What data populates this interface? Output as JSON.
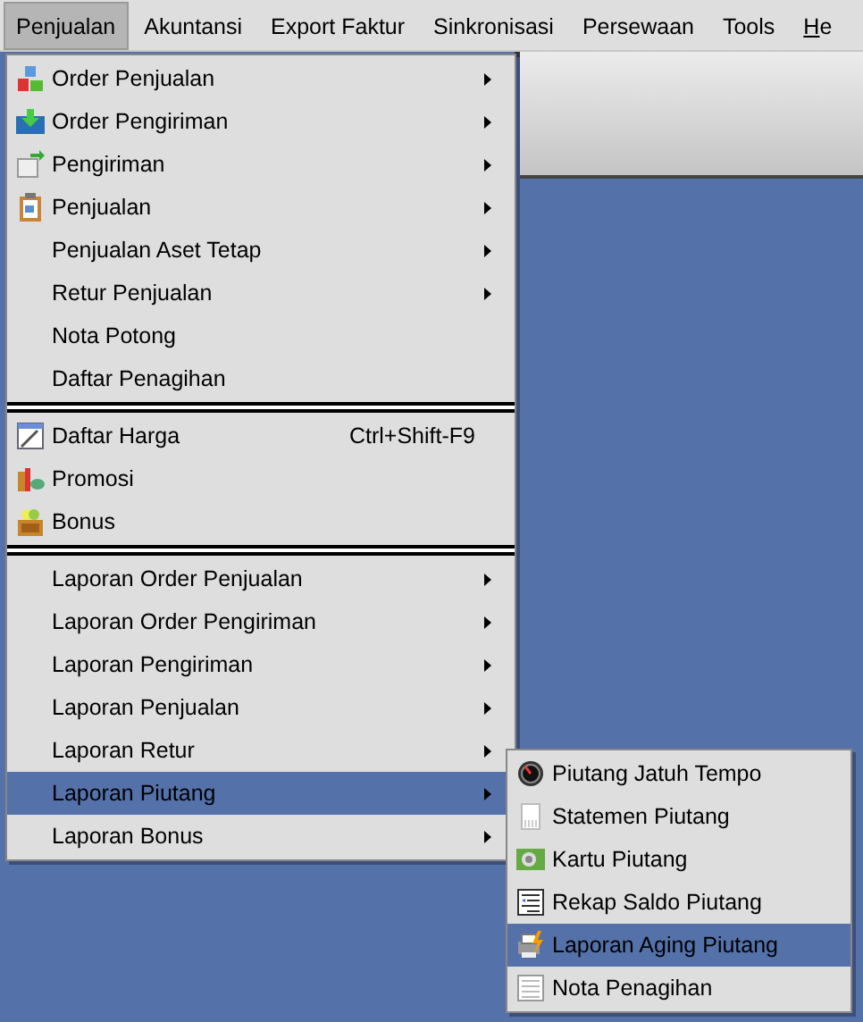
{
  "menubar": [
    {
      "label": "Penjualan",
      "selected": true
    },
    {
      "label": "Akuntansi",
      "selected": false
    },
    {
      "label": "Export Faktur",
      "selected": false
    },
    {
      "label": "Sinkronisasi",
      "selected": false
    },
    {
      "label": "Persewaan",
      "selected": false
    },
    {
      "label": "Tools",
      "selected": false
    },
    {
      "label": "He",
      "selected": false
    }
  ],
  "menu": [
    {
      "kind": "item",
      "label": "Order Penjualan",
      "has_icon": true,
      "submenu": true,
      "selected": false
    },
    {
      "kind": "item",
      "label": "Order Pengiriman",
      "has_icon": true,
      "submenu": true,
      "selected": false
    },
    {
      "kind": "item",
      "label": "Pengiriman",
      "has_icon": true,
      "submenu": true,
      "selected": false
    },
    {
      "kind": "item",
      "label": "Penjualan",
      "has_icon": true,
      "submenu": true,
      "selected": false
    },
    {
      "kind": "item",
      "label": "Penjualan Aset Tetap",
      "has_icon": false,
      "submenu": true,
      "selected": false
    },
    {
      "kind": "item",
      "label": "Retur Penjualan",
      "has_icon": false,
      "submenu": true,
      "selected": false
    },
    {
      "kind": "item",
      "label": "Nota Potong",
      "has_icon": false,
      "submenu": false,
      "selected": false
    },
    {
      "kind": "item",
      "label": "Daftar Penagihan",
      "has_icon": false,
      "submenu": false,
      "selected": false
    },
    {
      "kind": "separator"
    },
    {
      "kind": "item",
      "label": "Daftar Harga",
      "shortcut": "Ctrl+Shift-F9",
      "has_icon": true,
      "submenu": false,
      "selected": false
    },
    {
      "kind": "item",
      "label": "Promosi",
      "has_icon": true,
      "submenu": false,
      "selected": false
    },
    {
      "kind": "item",
      "label": "Bonus",
      "has_icon": true,
      "submenu": false,
      "selected": false
    },
    {
      "kind": "separator"
    },
    {
      "kind": "item",
      "label": "Laporan Order Penjualan",
      "has_icon": false,
      "submenu": true,
      "selected": false
    },
    {
      "kind": "item",
      "label": "Laporan Order Pengiriman",
      "has_icon": false,
      "submenu": true,
      "selected": false
    },
    {
      "kind": "item",
      "label": "Laporan Pengiriman",
      "has_icon": false,
      "submenu": true,
      "selected": false
    },
    {
      "kind": "item",
      "label": "Laporan Penjualan",
      "has_icon": false,
      "submenu": true,
      "selected": false
    },
    {
      "kind": "item",
      "label": "Laporan Retur",
      "has_icon": false,
      "submenu": true,
      "selected": false
    },
    {
      "kind": "item",
      "label": "Laporan Piutang",
      "has_icon": false,
      "submenu": true,
      "selected": true
    },
    {
      "kind": "item",
      "label": "Laporan Bonus",
      "has_icon": false,
      "submenu": true,
      "selected": false
    }
  ],
  "submenu": [
    {
      "label": "Piutang Jatuh Tempo",
      "selected": false
    },
    {
      "label": "Statemen Piutang",
      "selected": false
    },
    {
      "label": "Kartu Piutang",
      "selected": false
    },
    {
      "label": "Rekap Saldo Piutang",
      "selected": false
    },
    {
      "label": "Laporan Aging Piutang",
      "selected": true
    },
    {
      "label": "Nota Penagihan",
      "selected": false
    }
  ]
}
